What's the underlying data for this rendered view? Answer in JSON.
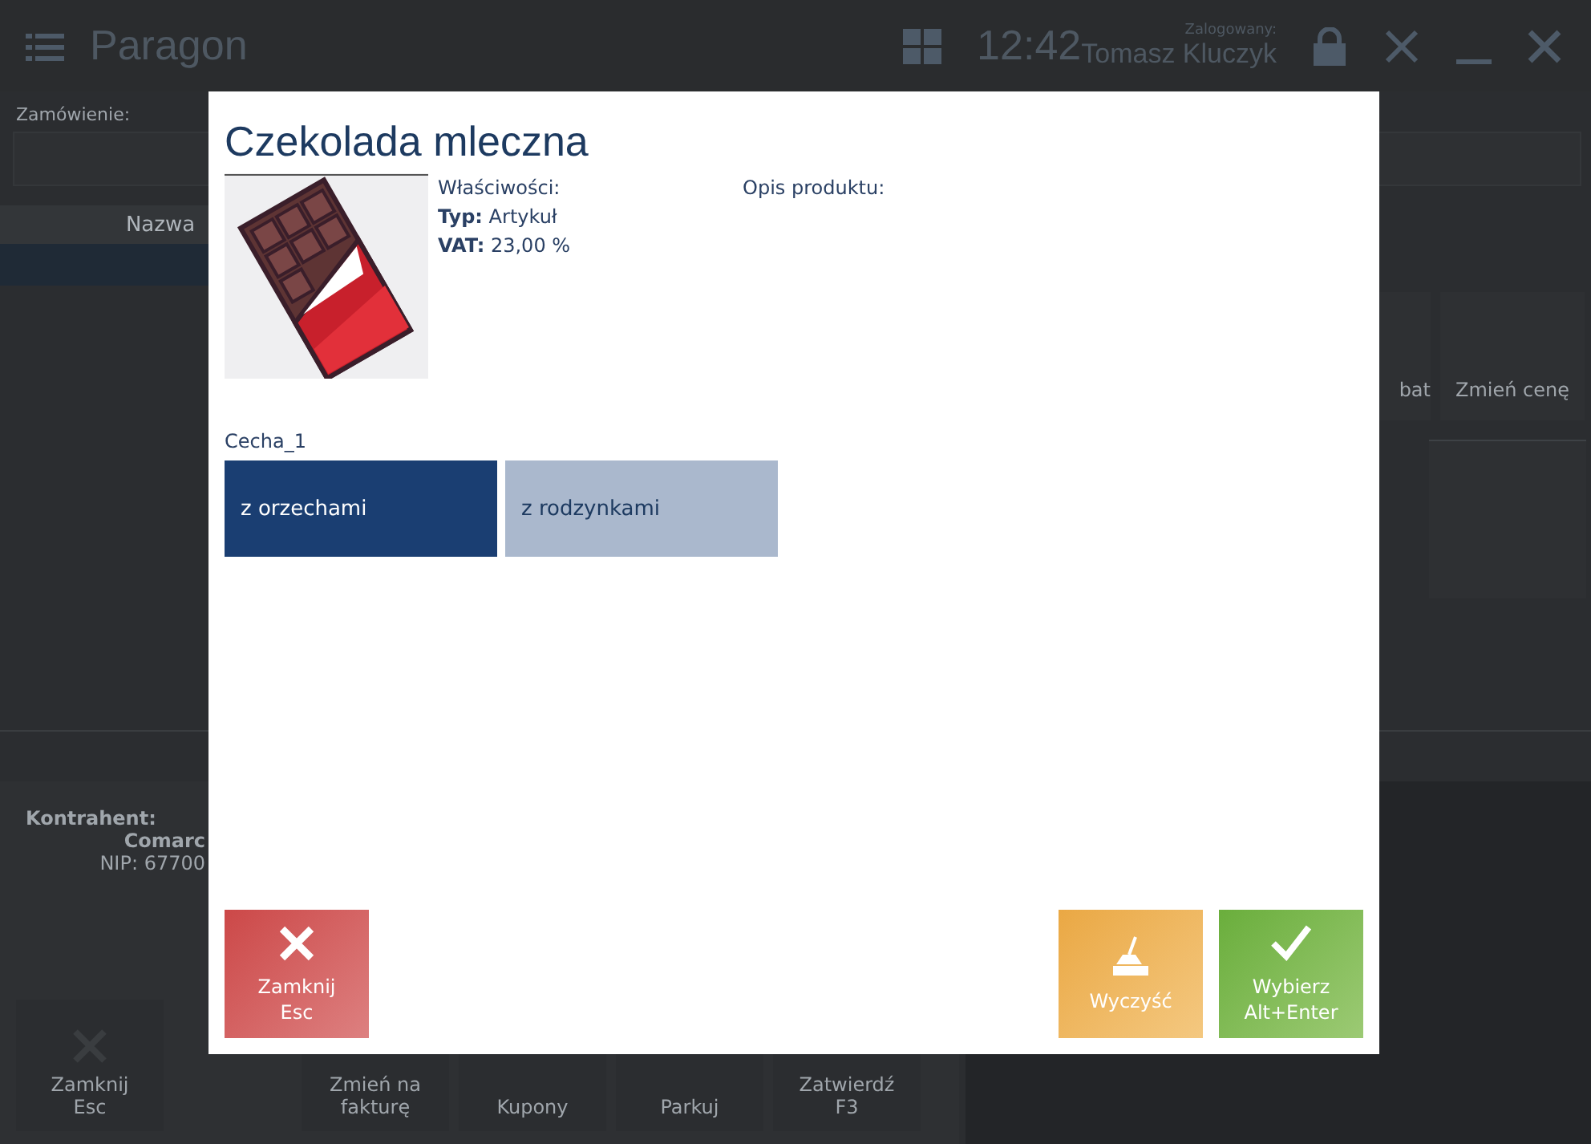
{
  "header": {
    "title": "Paragon",
    "time": "12:42",
    "user_label": "Zalogowany:",
    "user": "Tomasz Kluczyk"
  },
  "order": {
    "label": "Zamówienie:"
  },
  "table": {
    "columns": [
      "Nazwa"
    ]
  },
  "tiles": [
    {
      "label": "bat"
    },
    {
      "label": "Zmień cenę"
    }
  ],
  "customer": {
    "label": "Kontrahent:",
    "name": "Comarc",
    "nip": "NIP: 67700"
  },
  "bottom_buttons": [
    {
      "kind": "close",
      "label": "Zamknij",
      "shortcut": "Esc"
    },
    {
      "kind": "text",
      "label": "Zmień na fakturę"
    },
    {
      "kind": "text",
      "label": "Kupony"
    },
    {
      "kind": "text",
      "label": "Parkuj"
    },
    {
      "kind": "text",
      "label": "Zatwierdź",
      "shortcut": "F3"
    }
  ],
  "dialog": {
    "title": "Czekolada mleczna",
    "properties_label": "Właściwości:",
    "properties": [
      {
        "key": "Typ:",
        "value": "Artykuł"
      },
      {
        "key": "VAT:",
        "value": "23,00 %"
      }
    ],
    "description_label": "Opis produktu:",
    "feature": {
      "label": "Cecha_1",
      "options": [
        {
          "label": "z orzechami",
          "selected": true
        },
        {
          "label": "z rodzynkami",
          "selected": false
        }
      ]
    },
    "buttons": [
      {
        "kind": "close",
        "label": "Zamknij",
        "shortcut": "Esc"
      },
      {
        "kind": "clear",
        "label": "Wyczyść"
      },
      {
        "kind": "select",
        "label": "Wybierz",
        "shortcut": "Alt+Enter"
      }
    ]
  }
}
